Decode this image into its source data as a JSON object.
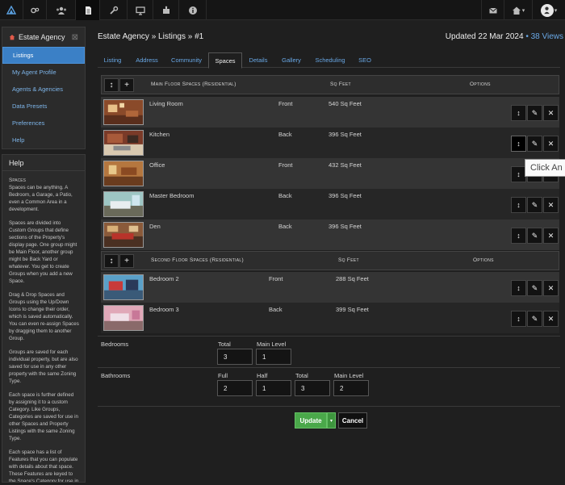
{
  "topnav": {
    "items": [
      {
        "icon": "dashboard-icon"
      },
      {
        "icon": "gears-icon"
      },
      {
        "icon": "users-icon"
      },
      {
        "icon": "document-icon"
      },
      {
        "icon": "wrench-icon"
      },
      {
        "icon": "desktop-icon"
      },
      {
        "icon": "puzzle-icon"
      },
      {
        "icon": "info-icon"
      }
    ],
    "right": {
      "mail_icon": "envelope-icon",
      "home_icon": "home-icon",
      "home_caret": "▾",
      "avatar_caret": "▾"
    }
  },
  "sidebar": {
    "title": "Estate Agency",
    "close": "⊠",
    "items": [
      {
        "label": "Listings"
      },
      {
        "label": "My Agent Profile"
      },
      {
        "label": "Agents & Agencies"
      },
      {
        "label": "Data Presets"
      },
      {
        "label": "Preferences"
      },
      {
        "label": "Help"
      }
    ]
  },
  "help": {
    "title": "Help",
    "heading": "Spaces",
    "paragraphs": [
      "Spaces can be anything. A Bedroom, a Garage, a Patio, even a Common Area in a development.",
      "Spaces are divided into Custom Groups that define sections of the Property's display page. One group might be Main Floor, another group might be Back Yard or whatever. You get to create Groups when you add a new Space.",
      "Drag & Drop Spaces and Groups using the Up/Down Icons to change their order, which is saved automatically. You can even re-assign Spaces by dragging them to another Group.",
      "Groups are saved for each individual property, but are also saved for use in any other property with the same Zoning Type.",
      "Each space is further defined by assigning it to a custom Category. Like Groups, Categories are saved for use in other Spaces and Property Listings with the same Zoning Type.",
      "Each space has a list of Features that you can populate with details about that space. These Features are keyed to the Space's Category for use in other Spaces with the same Category, and saved across Property Listings with the same"
    ]
  },
  "header": {
    "breadcrumb": "Estate Agency » Listings » #1",
    "updated": "Updated 22 Mar 2024",
    "views": "• 38 Views"
  },
  "tabs": [
    {
      "label": "Listing"
    },
    {
      "label": "Address"
    },
    {
      "label": "Community"
    },
    {
      "label": "Spaces"
    },
    {
      "label": "Details"
    },
    {
      "label": "Gallery"
    },
    {
      "label": "Scheduling"
    },
    {
      "label": "SEO"
    }
  ],
  "groups": [
    {
      "name": "Main Floor Spaces (Residential)",
      "col_ft": "Sq Feet",
      "col_opts": "Options",
      "spaces": [
        {
          "name": "Living Room",
          "location": "Front",
          "sqft": "540 Sq Feet"
        },
        {
          "name": "Kitchen",
          "location": "Back",
          "sqft": "396 Sq Feet"
        },
        {
          "name": "Office",
          "location": "Front",
          "sqft": "432 Sq Feet"
        },
        {
          "name": "Master Bedroom",
          "location": "Back",
          "sqft": "396 Sq Feet"
        },
        {
          "name": "Den",
          "location": "Back",
          "sqft": "396 Sq Feet"
        }
      ]
    },
    {
      "name": "Second Floor Spaces (Residential)",
      "col_ft": "Sq Feet",
      "col_opts": "Options",
      "spaces": [
        {
          "name": "Bedroom 2",
          "location": "Front",
          "sqft": "288 Sq Feet"
        },
        {
          "name": "Bedroom 3",
          "location": "Back",
          "sqft": "399 Sq Feet"
        }
      ]
    }
  ],
  "icons": {
    "move": "↕",
    "add": "+",
    "edit": "✎",
    "delete": "✕"
  },
  "tooltip": "Click An",
  "bedrooms": {
    "label": "Bedrooms",
    "total_label": "Total",
    "total": "3",
    "main_label": "Main Level",
    "main": "1"
  },
  "bathrooms": {
    "label": "Bathrooms",
    "full_label": "Full",
    "full": "2",
    "half_label": "Half",
    "half": "1",
    "total_label": "Total",
    "total": "3",
    "main_label": "Main Level",
    "main": "2"
  },
  "actions": {
    "update": "Update",
    "caret": "▾",
    "cancel": "Cancel"
  }
}
